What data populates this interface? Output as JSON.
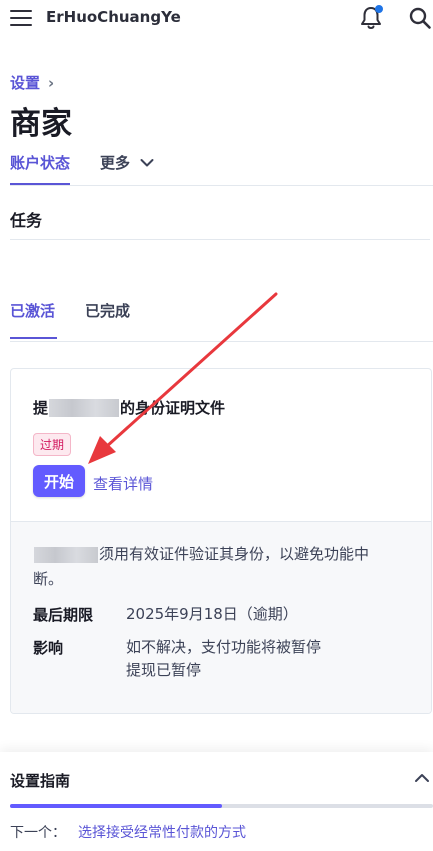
{
  "header": {
    "app_name": "ErHuoChuangYe",
    "icons": [
      "menu-icon",
      "bell-icon",
      "search-icon"
    ],
    "notification_dot_color": "#1f74e6"
  },
  "breadcrumb": {
    "parent": "设置",
    "separator": "›"
  },
  "page": {
    "title": "商家"
  },
  "main_tabs": [
    {
      "label": "账户状态",
      "active": true
    },
    {
      "label": "更多",
      "active": false
    }
  ],
  "tasks": {
    "title": "任务",
    "tabs": [
      {
        "label": "已激活",
        "active": true
      },
      {
        "label": "已完成",
        "active": false
      }
    ]
  },
  "task_card": {
    "title_prefix": "提",
    "title_suffix": "的身份证明文件",
    "status_badge": "过期",
    "start_button": "开始",
    "details_link": "查看详情",
    "description": "须用有效证件验证其身份，以避免功能中断。",
    "deadline_label": "最后期限",
    "deadline_value": "2025年9月18日（逾期）",
    "impact_label": "影响",
    "impact_line1": "如不解决，支付功能将被暂停",
    "impact_line2": "提现已暂停"
  },
  "guide": {
    "title": "设置指南",
    "progress_fraction": 0.5,
    "next_label": "下一个：",
    "next_link": "选择接受经常性付款的方式"
  },
  "colors": {
    "accent": "#635bff",
    "link": "#5a55d6",
    "badge_text": "#d3185f",
    "annotation_arrow": "#e8383d"
  }
}
